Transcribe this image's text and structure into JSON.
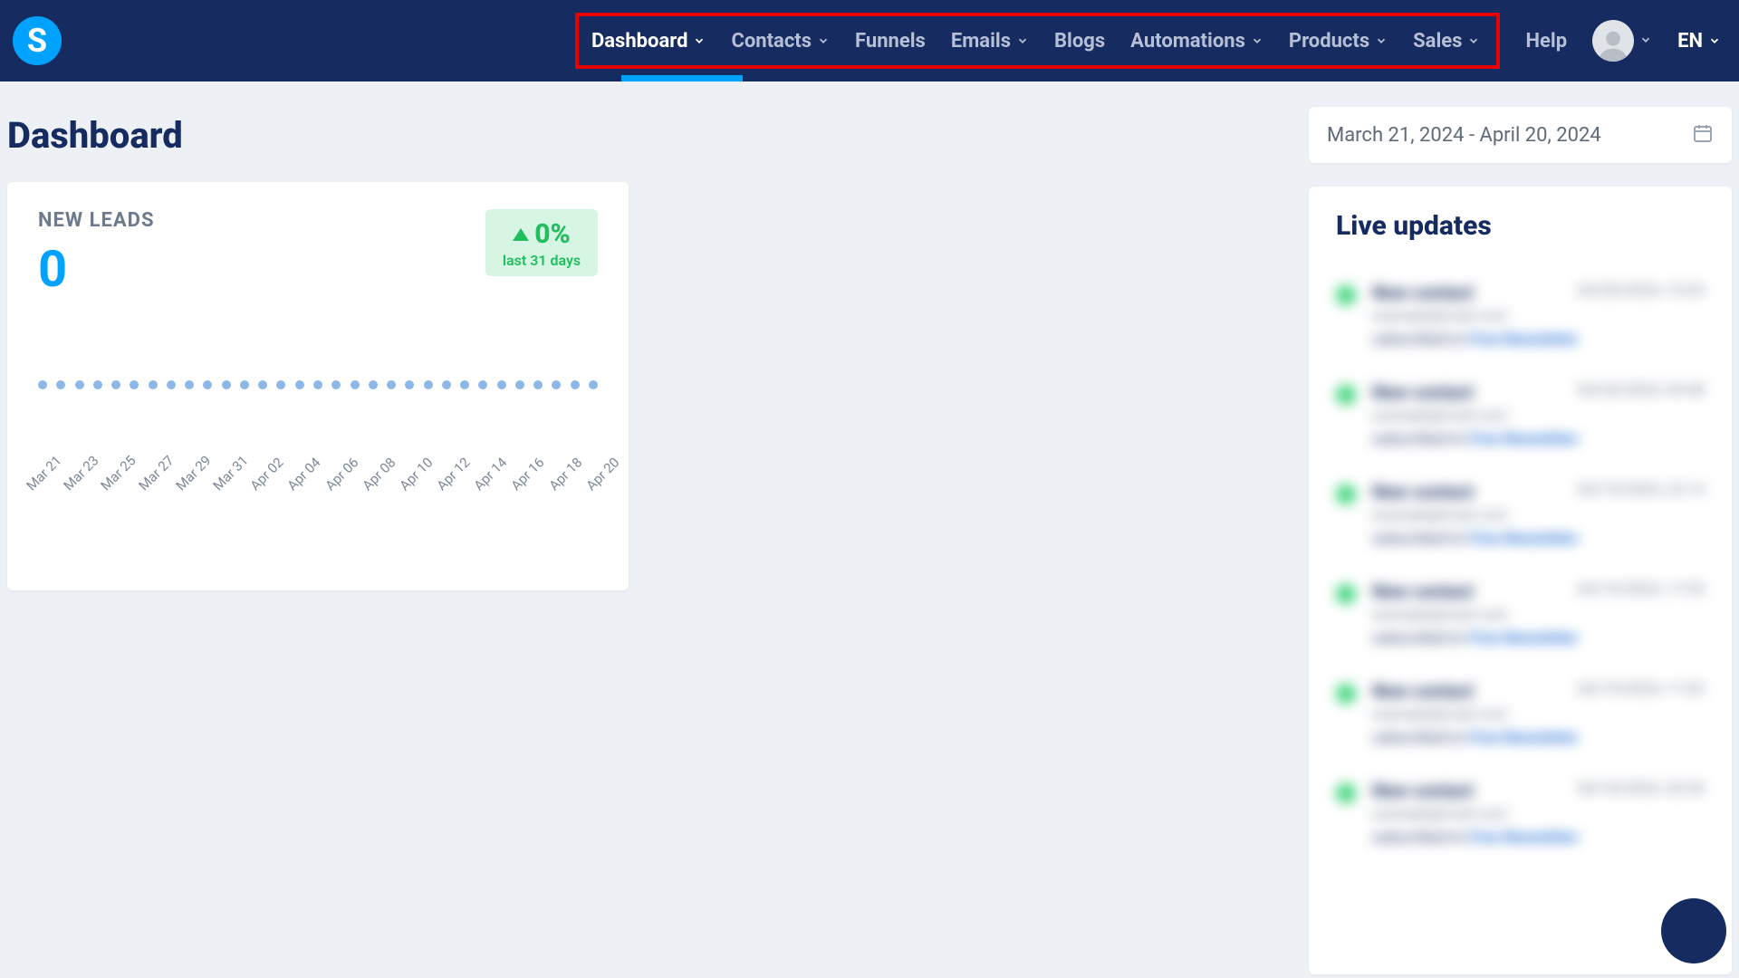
{
  "header": {
    "logo_letter": "S",
    "nav": [
      {
        "label": "Dashboard",
        "has_chevron": true,
        "active": true
      },
      {
        "label": "Contacts",
        "has_chevron": true,
        "active": false
      },
      {
        "label": "Funnels",
        "has_chevron": false,
        "active": false
      },
      {
        "label": "Emails",
        "has_chevron": true,
        "active": false
      },
      {
        "label": "Blogs",
        "has_chevron": false,
        "active": false
      },
      {
        "label": "Automations",
        "has_chevron": true,
        "active": false
      },
      {
        "label": "Products",
        "has_chevron": true,
        "active": false
      },
      {
        "label": "Sales",
        "has_chevron": true,
        "active": false
      }
    ],
    "help_label": "Help",
    "language": "EN"
  },
  "page": {
    "title": "Dashboard",
    "date_range": "March 21, 2024 - April 20, 2024"
  },
  "card": {
    "title": "NEW LEADS",
    "value": "0",
    "trend_pct": "0%",
    "trend_sub": "last 31 days"
  },
  "live": {
    "title": "Live updates",
    "items": [
      {
        "name": "New contact",
        "date": "04/20/2024, 10:24",
        "email": "example@mail.com",
        "action_prefix": "subscribed to ",
        "action_link": "Free Newsletter"
      },
      {
        "name": "New contact",
        "date": "04/20/2024, 09:48",
        "email": "example@mail.com",
        "action_prefix": "subscribed to ",
        "action_link": "Free Newsletter"
      },
      {
        "name": "New contact",
        "date": "04/19/2024, 22:14",
        "email": "example@mail.com",
        "action_prefix": "subscribed to ",
        "action_link": "Free Newsletter"
      },
      {
        "name": "New contact",
        "date": "04/19/2024, 17:53",
        "email": "example@mail.com",
        "action_prefix": "subscribed to ",
        "action_link": "Free Newsletter"
      },
      {
        "name": "New contact",
        "date": "04/19/2024, 11:02",
        "email": "example@mail.com",
        "action_prefix": "subscribed to ",
        "action_link": "Free Newsletter"
      },
      {
        "name": "New contact",
        "date": "04/18/2024, 20:36",
        "email": "example@mail.com",
        "action_prefix": "subscribed to ",
        "action_link": "Free Newsletter"
      }
    ]
  },
  "chart_data": {
    "type": "line",
    "title": "NEW LEADS",
    "xlabel": "",
    "ylabel": "",
    "categories": [
      "Mar 21",
      "Mar 23",
      "Mar 25",
      "Mar 27",
      "Mar 29",
      "Mar 31",
      "Apr 02",
      "Apr 04",
      "Apr 06",
      "Apr 08",
      "Apr 10",
      "Apr 12",
      "Apr 14",
      "Apr 16",
      "Apr 18",
      "Apr 20"
    ],
    "values": [
      0,
      0,
      0,
      0,
      0,
      0,
      0,
      0,
      0,
      0,
      0,
      0,
      0,
      0,
      0,
      0
    ],
    "ylim": [
      0,
      1
    ]
  }
}
